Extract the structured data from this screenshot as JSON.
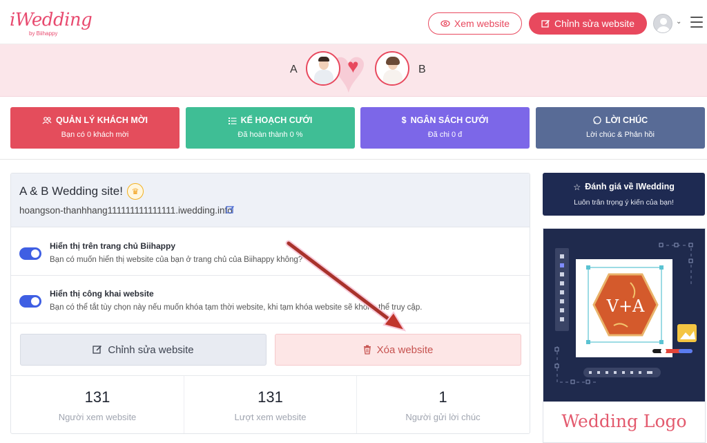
{
  "header": {
    "logo_text": "iWedding",
    "logo_sub": "by Biihappy",
    "view_website_label": "Xem website",
    "edit_website_label": "Chỉnh sửa website"
  },
  "couple": {
    "name_a": "A",
    "name_b": "B"
  },
  "cards": [
    {
      "title": "QUẢN LÝ KHÁCH MỜI",
      "subtitle": "Bạn có 0 khách mời",
      "icon": "users-icon",
      "color": "#e44d5c"
    },
    {
      "title": "KẾ HOẠCH CƯỚI",
      "subtitle": "Đã hoàn thành 0 %",
      "icon": "list-icon",
      "color": "#3fbe95"
    },
    {
      "title": "NGÂN SÁCH CƯỚI",
      "subtitle": "Đã chi 0 đ",
      "icon": "dollar-icon",
      "color": "#7c67e8"
    },
    {
      "title": "LỜI CHÚC",
      "subtitle": "Lời chúc & Phản hồi",
      "icon": "chat-icon",
      "color": "#586b96"
    }
  ],
  "site": {
    "title": "A & B Wedding site!",
    "url": "hoangson-thanhhang111111111111111.iwedding.info",
    "options": [
      {
        "title": "Hiển thị trên trang chủ Biihappy",
        "desc": "Bạn có muốn hiển thị website của bạn ở trang chủ của Biihappy không?",
        "enabled": true
      },
      {
        "title": "Hiển thị công khai website",
        "desc": "Bạn có thể tắt tùy chọn này nếu muốn khóa tạm thời website, khi tạm khóa website sẽ không thể truy cập.",
        "enabled": true
      }
    ],
    "edit_label": "Chỉnh sửa website",
    "delete_label": "Xóa website",
    "stats": [
      {
        "value": "131",
        "label": "Người xem website"
      },
      {
        "value": "131",
        "label": "Lượt xem website"
      },
      {
        "value": "1",
        "label": "Người gửi lời chúc"
      }
    ]
  },
  "review": {
    "title": "Đánh giá về IWedding",
    "subtitle": "Luôn trân trọng ý kiến của bạn!"
  },
  "promo": {
    "monogram": "V+A",
    "caption": "Wedding Logo"
  },
  "colors": {
    "brand": "#e8495e",
    "toggle_on": "#3f5fe3",
    "annotation_arrow": "#b0322a"
  }
}
